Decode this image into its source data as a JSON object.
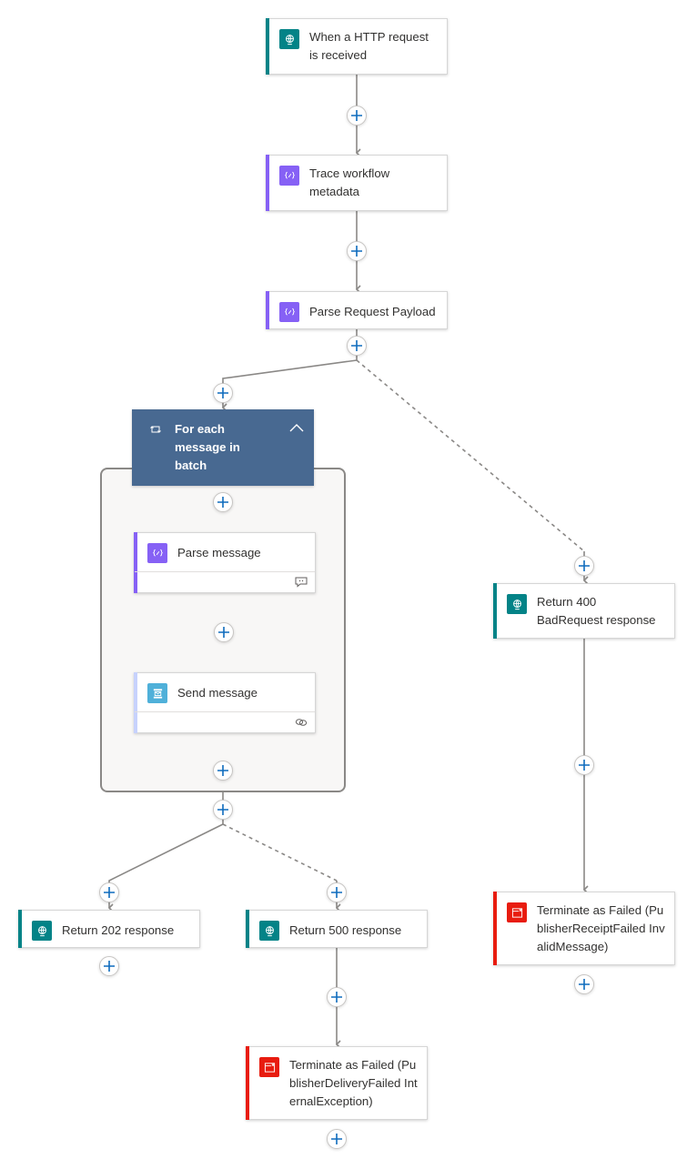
{
  "colors": {
    "http": "#038387",
    "compose": "#8661f5",
    "servicebus": "#4fb0d9",
    "servicebus_bar": "#c7d2fc",
    "terminate": "#e81c0f",
    "foreach": "#486991",
    "plus": "#0f6cbd",
    "wire": "#8a8886"
  },
  "nodes": {
    "http_trigger": {
      "title": "When a HTTP request is received",
      "icon": "globe-icon"
    },
    "trace_metadata": {
      "title": "Trace workflow metadata",
      "icon": "compose-icon"
    },
    "parse_payload": {
      "title": "Parse Request Payload",
      "icon": "compose-icon"
    },
    "foreach": {
      "title": "For each message in batch",
      "icon": "loop-icon",
      "collapse_icon": "chevron-up-icon"
    },
    "parse_message": {
      "title": "Parse message",
      "icon": "compose-icon",
      "footer_icon": "comment-icon"
    },
    "send_message": {
      "title": "Send message",
      "icon": "service-bus-icon",
      "footer_icon": "link-icon"
    },
    "return_400": {
      "title": "Return 400 BadRequest response",
      "icon": "globe-icon"
    },
    "return_202": {
      "title": "Return 202 response",
      "icon": "globe-icon"
    },
    "return_500": {
      "title": "Return 500 response",
      "icon": "globe-icon"
    },
    "terminate_receipt": {
      "title": "Terminate as Failed (PublisherReceiptFailed InvalidMessage)",
      "icon": "terminate-icon"
    },
    "terminate_delivery": {
      "title": "Terminate as Failed (PublisherDeliveryFailed InternalException)",
      "icon": "terminate-icon"
    }
  },
  "add_step_label": "Insert a new step"
}
